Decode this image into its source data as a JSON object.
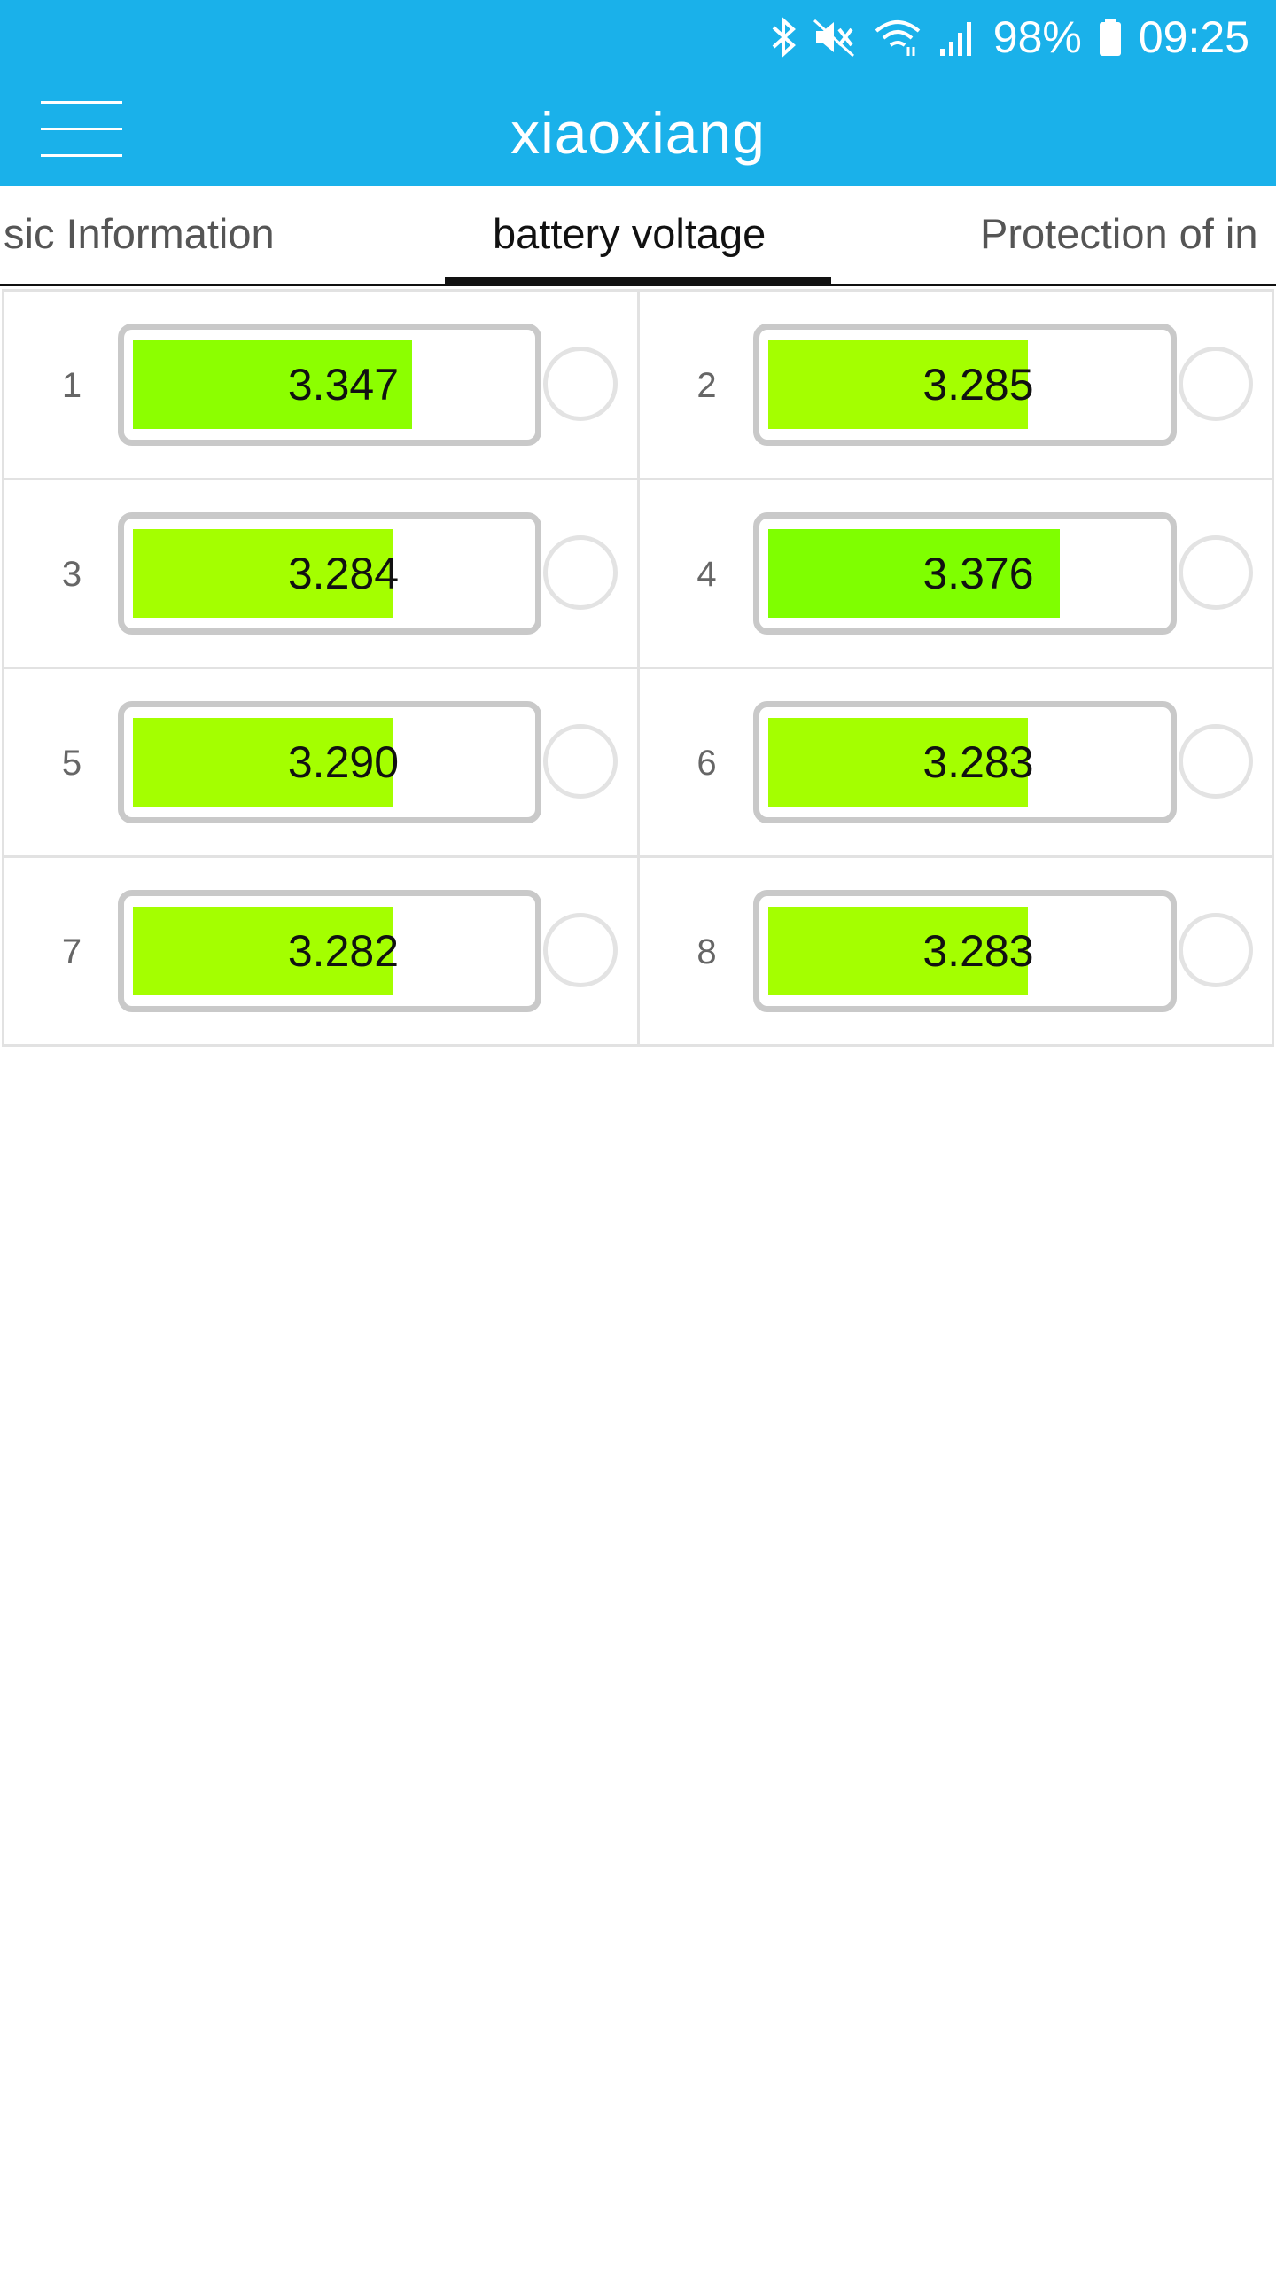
{
  "status_bar": {
    "battery_percent": "98%",
    "time": "09:25",
    "icons": [
      "bluetooth-icon",
      "mute-icon",
      "wifi-icon",
      "signal-icon",
      "battery-icon"
    ]
  },
  "app": {
    "title": "xiaoxiang",
    "primary_color": "#1ab1ea"
  },
  "tabs": [
    {
      "label": "sic Information",
      "active": false
    },
    {
      "label": "battery voltage",
      "active": true
    },
    {
      "label": "Protection of in",
      "active": false
    }
  ],
  "cells": [
    {
      "index": "1",
      "voltage": "3.347",
      "level": 0.71,
      "color": "#8cff00"
    },
    {
      "index": "2",
      "voltage": "3.285",
      "level": 0.66,
      "color": "#a4ff00"
    },
    {
      "index": "3",
      "voltage": "3.284",
      "level": 0.66,
      "color": "#a4ff00"
    },
    {
      "index": "4",
      "voltage": "3.376",
      "level": 0.74,
      "color": "#7fff00"
    },
    {
      "index": "5",
      "voltage": "3.290",
      "level": 0.66,
      "color": "#a4ff00"
    },
    {
      "index": "6",
      "voltage": "3.283",
      "level": 0.66,
      "color": "#a4ff00"
    },
    {
      "index": "7",
      "voltage": "3.282",
      "level": 0.66,
      "color": "#a4ff00"
    },
    {
      "index": "8",
      "voltage": "3.283",
      "level": 0.66,
      "color": "#a4ff00"
    }
  ]
}
